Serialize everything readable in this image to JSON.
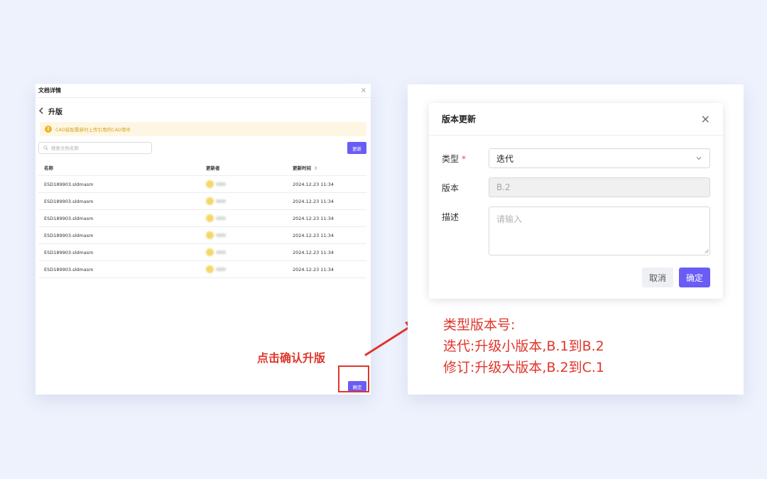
{
  "left": {
    "window_title": "文档详情",
    "close_glyph": "×",
    "page_title": "升版",
    "warning_text": "CAD装配重新时上传引用的CAD零件",
    "search_placeholder": "搜索文档名称",
    "update_button": "更新",
    "columns": {
      "name": "名称",
      "updater": "更新者",
      "time": "更新时间"
    },
    "rows": [
      {
        "name": "ESD189903.sldmasm",
        "time": "2024.12.23 11:34"
      },
      {
        "name": "ESD189903.sldmasm",
        "time": "2024.12.23 11:34"
      },
      {
        "name": "ESD189903.sldmasm",
        "time": "2024.12.23 11:34"
      },
      {
        "name": "ESD189903.sldmasm",
        "time": "2024.12.23 11:34"
      },
      {
        "name": "ESD189903.sldmasm",
        "time": "2024.12.23 11:34"
      },
      {
        "name": "ESD189903.sldmasm",
        "time": "2024.12.23 11:34"
      }
    ],
    "confirm_button": "确定"
  },
  "annotation": "点击确认升版",
  "dialog": {
    "title": "版本更新",
    "close_glyph": "×",
    "type_label": "类型",
    "required_mark": "*",
    "type_value": "迭代",
    "version_label": "版本",
    "version_value": "B.2",
    "desc_label": "描述",
    "desc_placeholder": "请输入",
    "cancel_button": "取消",
    "ok_button": "确定"
  },
  "notes": [
    "类型版本号:",
    "迭代:升级小版本,B.1到B.2",
    "修订:升级大版本,B.2到C.1"
  ],
  "colors": {
    "accent": "#6a5cf5",
    "annotation_red": "#e0352b",
    "warning_bg": "#fdf6e3",
    "warning_text": "#d6a21e",
    "page_bg": "#eef2fd"
  },
  "icons": [
    "close-icon",
    "back-arrow-icon",
    "warning-icon",
    "search-icon",
    "sort-icon",
    "chevron-down-icon",
    "arrow-icon"
  ]
}
